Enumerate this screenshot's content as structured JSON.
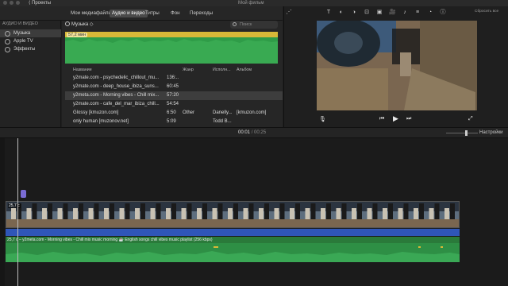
{
  "window": {
    "back_label": "⟨ Проекты",
    "title": "Мой фильм"
  },
  "tabs": [
    {
      "label": "Мои медиафайлы",
      "active": false
    },
    {
      "label": "Аудио и видео",
      "active": true
    },
    {
      "label": "Титры",
      "active": false
    },
    {
      "label": "Фон",
      "active": false
    },
    {
      "label": "Переходы",
      "active": false
    }
  ],
  "sidebar": {
    "header": "АУДИО И ВИДЕО",
    "items": [
      {
        "label": "Музыка",
        "selected": true
      },
      {
        "label": "Apple TV",
        "selected": false
      },
      {
        "label": "Эффекты",
        "selected": false
      }
    ]
  },
  "library": {
    "header": "Музыка ◇",
    "search_placeholder": "Поиск",
    "preview_duration": "57,2 мин",
    "columns": [
      "Название",
      "",
      "Жанр",
      "Исполн...",
      "Альбом"
    ],
    "rows": [
      {
        "name": "y2mate.com - psychedelic_chillout_mu...",
        "time": "136:..",
        "genre": "",
        "artist": "",
        "album": "",
        "selected": false
      },
      {
        "name": "y2mate.com - deep_house_ibiza_suns...",
        "time": "60:45",
        "genre": "",
        "artist": "",
        "album": "",
        "selected": false
      },
      {
        "name": "y2meta.com - Morning vibes - Chill mix...",
        "time": "57:20",
        "genre": "",
        "artist": "",
        "album": "",
        "selected": true
      },
      {
        "name": "y2mate.com - cafe_del_mar_ibiza_chill...",
        "time": "54:54",
        "genre": "",
        "artist": "",
        "album": "",
        "selected": false
      },
      {
        "name": "Glossy [kmuzon.com]",
        "time": "6:50",
        "genre": "Other",
        "artist": "Danelly...",
        "album": "[kmuzon.com]",
        "selected": false
      },
      {
        "name": "only human [muzonov.net]",
        "time": "5:09",
        "genre": "",
        "artist": "Todd B...",
        "album": "",
        "selected": false
      }
    ]
  },
  "viewer": {
    "reset_label": "Сбросить все",
    "tools": [
      "T",
      "◐",
      "◑",
      "⊡",
      "▣",
      "🎥",
      "♪",
      "≡",
      "◔",
      "ⓘ"
    ]
  },
  "timeline": {
    "current_time": "00:01",
    "separator": "/",
    "total_time": "00:25",
    "settings_label": "Настройки",
    "video_label": "25,7 с",
    "audio_label": "25,7 с – y2meta.com - Morning vibes - Chill mix music morning ☕ English songs chill vibes music playlist (256 kbps)"
  },
  "colors": {
    "audio_green": "#2e8f45",
    "waveform_yellow": "#d8b838",
    "blue_bar": "#2f56b8",
    "selection": "#3d3d3d"
  }
}
